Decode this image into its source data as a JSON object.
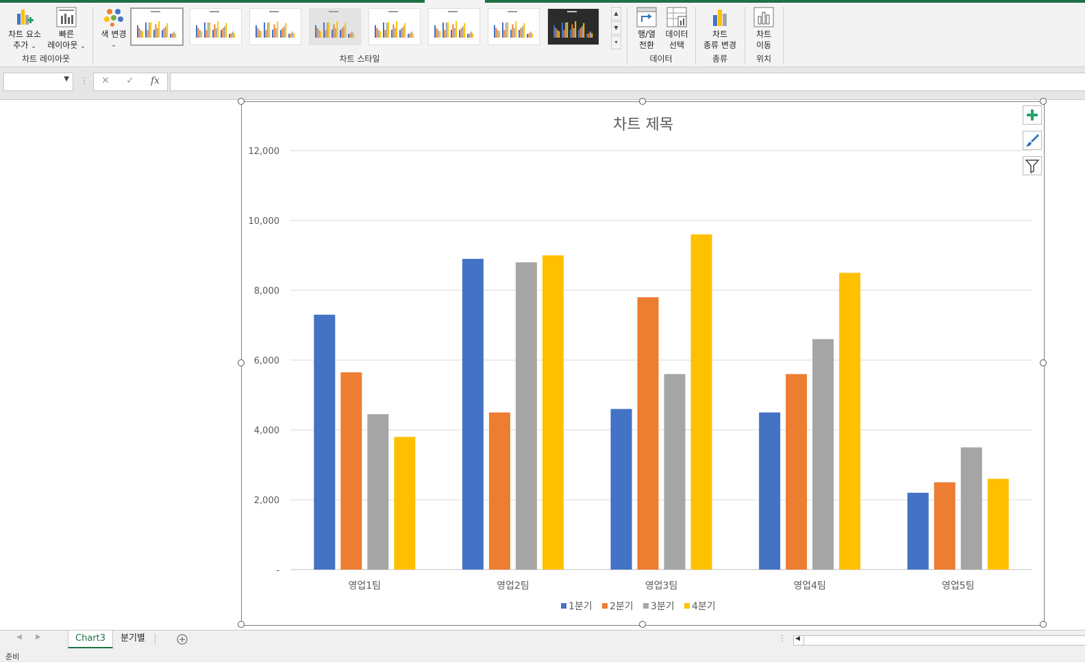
{
  "ribbon": {
    "add_element": {
      "line1": "차트 요소",
      "line2": "추가"
    },
    "quick_layout": {
      "line1": "빠른",
      "line2": "레이아웃"
    },
    "chart_layout_group": "차트 레이아웃",
    "change_colors": "색 변경",
    "chart_styles_group": "차트 스타일",
    "switch_rowcol": {
      "line1": "행/열",
      "line2": "전환"
    },
    "select_data": {
      "line1": "데이터",
      "line2": "선택"
    },
    "data_group": "데이터",
    "change_type": {
      "line1": "차트",
      "line2": "종류 변경"
    },
    "type_group": "종류",
    "move_chart": {
      "line1": "차트",
      "line2": "이동"
    },
    "location_group": "위치"
  },
  "formula_bar": {
    "name_box": "",
    "formula": "",
    "fx": "fx"
  },
  "chart_data": {
    "type": "bar",
    "title": "차트 제목",
    "categories": [
      "영업1팀",
      "영업2팀",
      "영업3팀",
      "영업4팀",
      "영업5팀"
    ],
    "series": [
      {
        "name": "1분기",
        "color": "#4472c4",
        "values": [
          7300,
          8900,
          4600,
          4500,
          2200
        ]
      },
      {
        "name": "2분기",
        "color": "#ed7d31",
        "values": [
          5650,
          4500,
          7800,
          5600,
          2500
        ]
      },
      {
        "name": "3분기",
        "color": "#a5a5a5",
        "values": [
          4450,
          8800,
          5600,
          6600,
          3500
        ]
      },
      {
        "name": "4분기",
        "color": "#ffc000",
        "values": [
          3800,
          9000,
          9600,
          8500,
          2600
        ]
      }
    ],
    "ylim": [
      0,
      12000
    ],
    "yticks": [
      0,
      2000,
      4000,
      6000,
      8000,
      10000,
      12000
    ],
    "ytick_labels": [
      "-",
      "2,000",
      "4,000",
      "6,000",
      "8,000",
      "10,000",
      "12,000"
    ],
    "grid": true,
    "legend": "bottom"
  },
  "sheet_tabs": [
    "Chart3",
    "분기별"
  ],
  "status": "준비"
}
